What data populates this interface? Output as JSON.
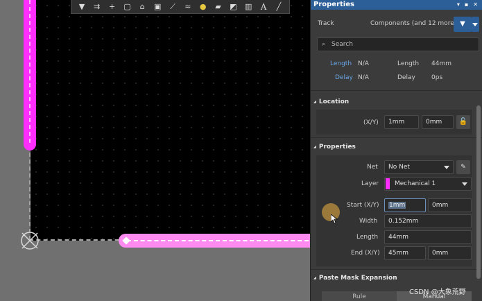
{
  "toolbar": {
    "icons": [
      "filter-icon",
      "route-icon",
      "cross-probe-icon",
      "rectangle-select-icon",
      "component-icon",
      "pad-icon",
      "interactive-route-icon",
      "diff-pair-icon",
      "via-icon",
      "polygon-icon",
      "region-icon",
      "chart-icon",
      "text-icon",
      "line-icon"
    ]
  },
  "panel": {
    "title": "Properties",
    "object_type": "Track",
    "filter_scope": "Components (and 12 more)",
    "search_placeholder": "Search",
    "summary": {
      "length_label_1": "Length",
      "length_value_1": "N/A",
      "length_label_2": "Length",
      "length_value_2": "44mm",
      "delay_label_1": "Delay",
      "delay_value_1": "N/A",
      "delay_label_2": "Delay",
      "delay_value_2": "0ps"
    },
    "location": {
      "title": "Location",
      "xy_label": "(X/Y)",
      "x": "1mm",
      "y": "0mm"
    },
    "properties": {
      "title": "Properties",
      "net_label": "Net",
      "net_value": "No Net",
      "layer_label": "Layer",
      "layer_value": "Mechanical 1",
      "layer_color": "#ff2eff",
      "start_label": "Start (X/Y)",
      "start_x": "1mm",
      "start_y": "0mm",
      "width_label": "Width",
      "width_value": "0.152mm",
      "length_label": "Length",
      "length_value": "44mm",
      "end_label": "End (X/Y)",
      "end_x": "45mm",
      "end_y": "0mm"
    },
    "paste_mask": {
      "title": "Paste Mask Expansion",
      "rule_label": "Rule",
      "manual_label": "Manual"
    }
  },
  "watermark": "CSDN @大象荒野",
  "colors": {
    "accent": "#2c5f97",
    "track": "#ff2eff",
    "track_selected": "#ff8af0"
  }
}
